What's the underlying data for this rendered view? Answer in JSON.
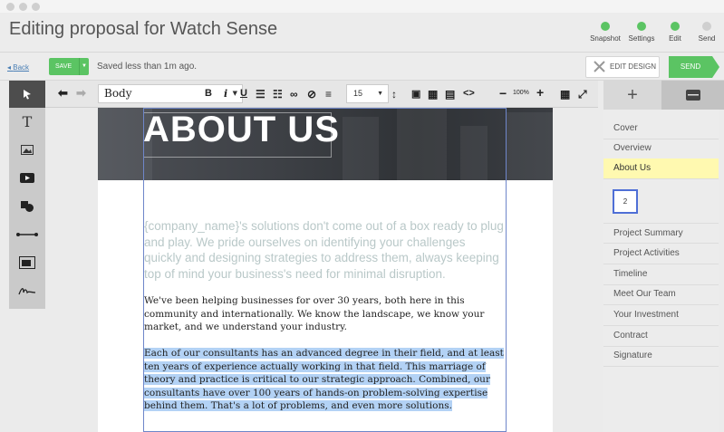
{
  "header": {
    "title": "Editing proposal for Watch Sense",
    "steps": [
      {
        "label": "Snapshot",
        "color": "#5bc463"
      },
      {
        "label": "Settings",
        "color": "#5bc463"
      },
      {
        "label": "Edit",
        "color": "#5bc463"
      },
      {
        "label": "Send",
        "color": "#cfcfcf"
      }
    ]
  },
  "subbar": {
    "back_label": "Back",
    "save_label": "SAVE",
    "saved_status": "Saved less than 1m ago.",
    "edit_design_label": "EDIT DESIGN",
    "send_label": "SEND"
  },
  "toolbar": {
    "style_value": "Body",
    "font_size_value": "15",
    "zoom_value": "100%"
  },
  "document": {
    "hero_title": "ABOUT US",
    "intro": "{company_name}'s solutions don't come out of a box ready to plug and play. We pride ourselves on identifying your challenges quickly and designing strategies to address them, always keeping top of mind your business's need for minimal disruption.",
    "para1": "We've been helping businesses for over 30 years, both here in this community and internationally. We know the landscape, we know your market, and we understand your industry.",
    "para2": "Each of our consultants has an advanced degree in their field, and at least ten years of experience actually working in that field. This marriage of theory and practice is critical to our strategic approach. Combined, our consultants have over 100 years of hands-on problem-solving expertise behind them. That's a lot of problems, and even more solutions."
  },
  "sidebar": {
    "sections": [
      {
        "label": "Cover"
      },
      {
        "label": "Overview"
      },
      {
        "label": "About Us"
      },
      {
        "label": "Project Summary"
      },
      {
        "label": "Project Activities"
      },
      {
        "label": "Timeline"
      },
      {
        "label": "Meet Our Team"
      },
      {
        "label": "Your Investment"
      },
      {
        "label": "Contract"
      },
      {
        "label": "Signature"
      }
    ],
    "active_section": "About Us",
    "thumbnail_label": "2"
  },
  "colors": {
    "accent_green": "#5bc463",
    "selection_blue": "#6e86c9",
    "active_item": "#fff9b0"
  }
}
